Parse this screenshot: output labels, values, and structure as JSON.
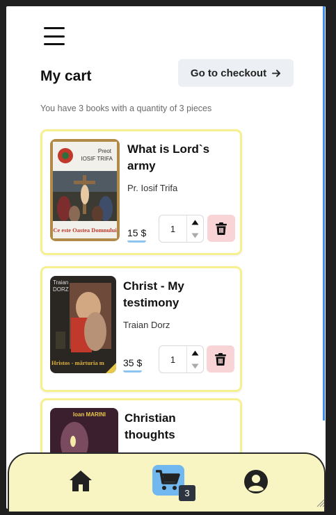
{
  "header": {
    "menu_icon": "hamburger-menu-icon",
    "title": "My cart",
    "checkout_label": "Go to checkout",
    "checkout_icon": "arrow-right-icon"
  },
  "summary": "You have 3 books with a quantity of 3 pieces",
  "cart_items": [
    {
      "title": "What is Lord`s army",
      "author": "Pr. Iosif Trifa",
      "price": "15 $",
      "quantity": "1",
      "cover_text_top_1": "Preot",
      "cover_text_top_2": "IOSIF TRIFA",
      "cover_text_bottom": "Ce este Oastea Domnului"
    },
    {
      "title": "Christ - My testimony",
      "author": "Traian Dorz",
      "price": "35 $",
      "quantity": "1",
      "cover_text_top_1": "Traian",
      "cover_text_top_2": "DORZ",
      "cover_text_bottom": "Hristos - mărturia m"
    },
    {
      "title": "Christian thoughts",
      "cover_text_top_1": "Ioan MARINI"
    }
  ],
  "bottom_nav": {
    "home_icon": "home-icon",
    "cart_icon": "shopping-cart-icon",
    "cart_count": "3",
    "profile_icon": "user-circle-icon"
  },
  "colors": {
    "card_border": "#f6f08e",
    "checkout_bg": "#ecf0f4",
    "delete_bg": "#f9d4d6",
    "price_underline": "#8fc4ef",
    "nav_bg": "#f9f5c3",
    "active_nav": "#71b7f0",
    "scrollbar": "#3c8df0"
  }
}
